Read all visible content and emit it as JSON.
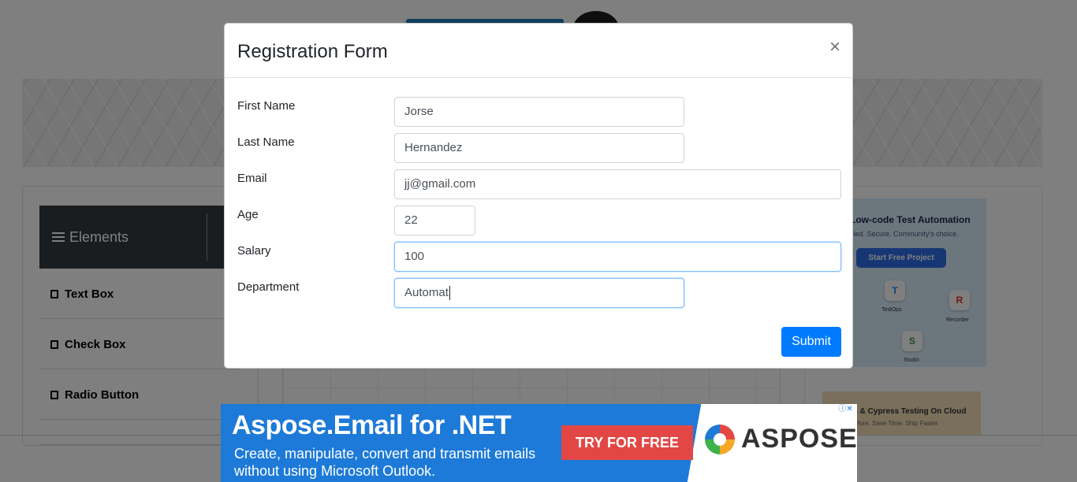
{
  "background": {
    "sidebar": {
      "header": "Elements",
      "items": [
        "Text Box",
        "Check Box",
        "Radio Button"
      ]
    },
    "side_ad": {
      "headline": "Low-code Test Automation",
      "subline": "fied. Secure. Community's choice.",
      "cta": "Start Free Project",
      "tiles": [
        {
          "letter": "T",
          "label": "TestOps"
        },
        {
          "letter": "R",
          "label": "Recorder"
        },
        {
          "letter": "S",
          "label": "Studio"
        }
      ]
    },
    "side_ad2": {
      "headline": "m & Cypress Testing On Cloud",
      "subline": "t More. Save Time. Ship Faster."
    }
  },
  "modal": {
    "title": "Registration Form",
    "close_icon": "×",
    "fields": [
      {
        "label": "First Name",
        "value": "Jorse"
      },
      {
        "label": "Last Name",
        "value": "Hernandez"
      },
      {
        "label": "Email",
        "value": "jj@gmail.com"
      },
      {
        "label": "Age",
        "value": "22"
      },
      {
        "label": "Salary",
        "value": "100"
      },
      {
        "label": "Department",
        "value": "Automat"
      }
    ],
    "submit_label": "Submit"
  },
  "bottom_ad": {
    "headline": "Aspose.Email for .NET",
    "body_line1": "Create, manipulate, convert and transmit emails",
    "body_line2": "without using Microsoft Outlook.",
    "cta": "TRY FOR FREE",
    "brand": "ASPOSE",
    "adchoices": "ⓘ✕"
  },
  "colors": {
    "primary": "#007bff",
    "sidebar_header": "#343a40",
    "ad_blue": "#1d7ad8",
    "ad_red": "#e24745"
  }
}
